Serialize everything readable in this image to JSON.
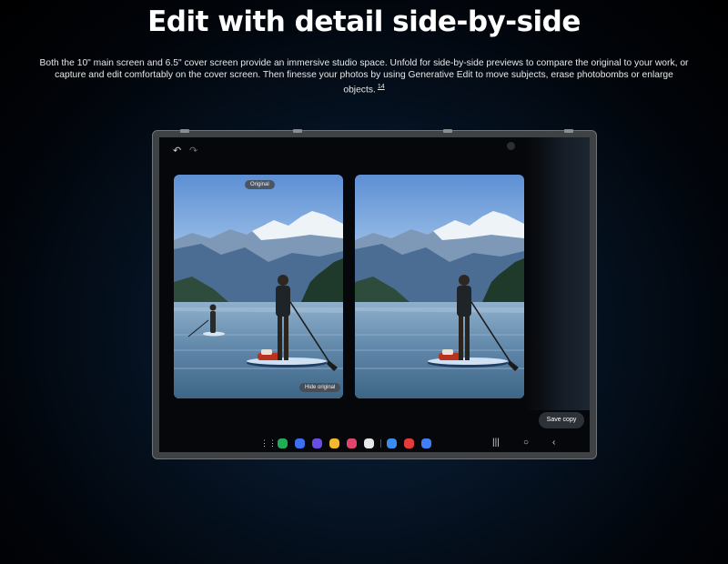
{
  "headline": "Edit with detail side-by-side",
  "description": "Both the 10\" main screen and 6.5\" cover screen provide an immersive studio space. Unfold for side-by-side previews to compare the original to your work, or capture and edit comfortably on the cover screen. Then finesse your photos by using Generative Edit to move subjects, erase photobombs or enlarge objects.",
  "footnote": "14",
  "device": {
    "toolbar": {
      "undo_icon": "undo-icon",
      "redo_icon": "redo-icon"
    },
    "original_badge": "Original",
    "hide_original_label": "Hide original",
    "save_copy_label": "Save copy",
    "taskbar": {
      "apps": [
        {
          "name": "phone-app",
          "color": "#1fae55"
        },
        {
          "name": "messages-app",
          "color": "#3e6ff0"
        },
        {
          "name": "browser-app",
          "color": "#6a4ce6"
        },
        {
          "name": "files-app",
          "color": "#f2b631"
        },
        {
          "name": "gallery-app",
          "color": "#e2446e"
        },
        {
          "name": "camera-app",
          "color": "#e8e8e8"
        },
        {
          "name": "dex-app",
          "color": "#3a8cf0"
        },
        {
          "name": "notes-app",
          "color": "#e63b3b"
        },
        {
          "name": "cloud-app",
          "color": "#3f7ef5"
        }
      ],
      "nav_icons": [
        "recents-icon",
        "home-icon",
        "back-icon"
      ]
    }
  }
}
